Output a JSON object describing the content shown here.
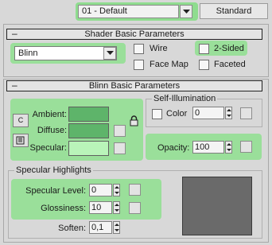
{
  "toolbar": {
    "material_name": "01 - Default",
    "material_type_button": "Standard"
  },
  "shader_basic": {
    "title": "Shader Basic Parameters",
    "collapse_symbol": "–",
    "shader_value": "Blinn",
    "options": {
      "wire": "Wire",
      "two_sided": "2-Sided",
      "face_map": "Face Map",
      "faceted": "Faceted"
    }
  },
  "blinn_basic": {
    "title": "Blinn Basic Parameters",
    "collapse_symbol": "–",
    "ambient_label": "Ambient:",
    "diffuse_label": "Diffuse:",
    "specular_label": "Specular:",
    "lock_letter_c": "C",
    "self_illum": {
      "title": "Self-Illumination",
      "color_label": "Color",
      "value": "0"
    },
    "opacity": {
      "label": "Opacity:",
      "value": "100"
    }
  },
  "specular_highlights": {
    "title": "Specular Highlights",
    "level_label": "Specular Level:",
    "level_value": "0",
    "gloss_label": "Glossiness:",
    "gloss_value": "10",
    "soften_label": "Soften:",
    "soften_value": "0,1"
  },
  "colors": {
    "highlight_green": "#9adf9a",
    "ambient_swatch": "#5eb46a",
    "diffuse_swatch": "#5eb46a",
    "specular_swatch": "#b9f4b9",
    "preview_gray": "#6a6a6a"
  },
  "icons": {
    "eyedropper": "eyedropper-icon",
    "dropdown_arrow": "chevron-down-icon",
    "lock": "lock-icon"
  }
}
